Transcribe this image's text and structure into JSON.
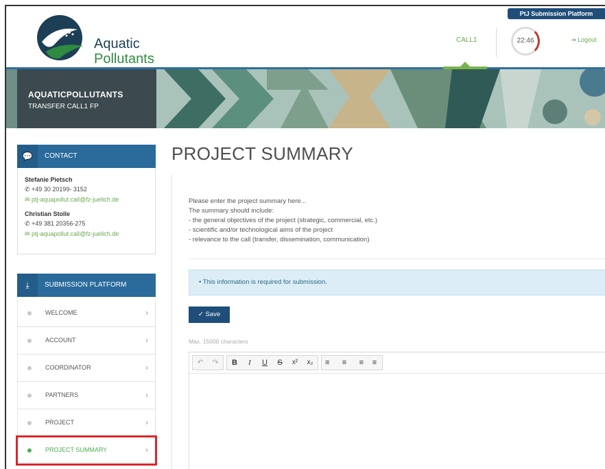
{
  "header": {
    "logo_line1": "Aquatic",
    "logo_line2": "Pollutants",
    "platform_badge": "PtJ Submission Platform",
    "call_tab": "CALL1",
    "timer": "22:46",
    "logout": "Logout"
  },
  "banner": {
    "title": "AQUATICPOLLUTANTS",
    "subtitle": "TRANSFER CALL1 FP"
  },
  "contact": {
    "heading": "CONTACT",
    "people": [
      {
        "name": "Stefanie Pietsch",
        "phone": "+49 30 20199- 3152",
        "email": "ptj-aquapollut.call@fz-juelich.de"
      },
      {
        "name": "Christian Stolle",
        "phone": "+49 381 20356-275",
        "email": "ptj-aquapollut.call@fz-juelich.de"
      }
    ]
  },
  "nav": {
    "heading": "SUBMISSION PLATFORM",
    "items": [
      {
        "label": "WELCOME"
      },
      {
        "label": "ACCOUNT"
      },
      {
        "label": "COORDINATOR"
      },
      {
        "label": "PARTNERS"
      },
      {
        "label": "PROJECT"
      },
      {
        "label": "PROJECT SUMMARY",
        "active": true
      }
    ]
  },
  "main": {
    "title": "PROJECT SUMMARY",
    "instructions": [
      "Please enter the project summary here...",
      "The summary should include:",
      "- the general objectives of the project (strategic, commercial, etc.)",
      "- scientific and/or technological aims of the project",
      "- relevance to the call (transfer, dissemination, communication)"
    ],
    "info_text": "• This information is required for submission.",
    "save_label": "✓  Save",
    "max_chars": "Max. 15000 characters"
  },
  "toolbar": {
    "undo": "↶",
    "redo": "↷",
    "bold": "B",
    "italic": "I",
    "underline": "U",
    "strike": "S",
    "superscript": "x²",
    "subscript": "x₂",
    "align_left": "≡",
    "align_center": "≡",
    "align_right": "≡",
    "justify": "≡"
  },
  "colors": {
    "brand_blue": "#2a6b9c",
    "dark_blue": "#1f4e7a",
    "accent_green": "#6aa84f",
    "active_green": "#4caf50",
    "highlight_red": "#d9262a"
  }
}
